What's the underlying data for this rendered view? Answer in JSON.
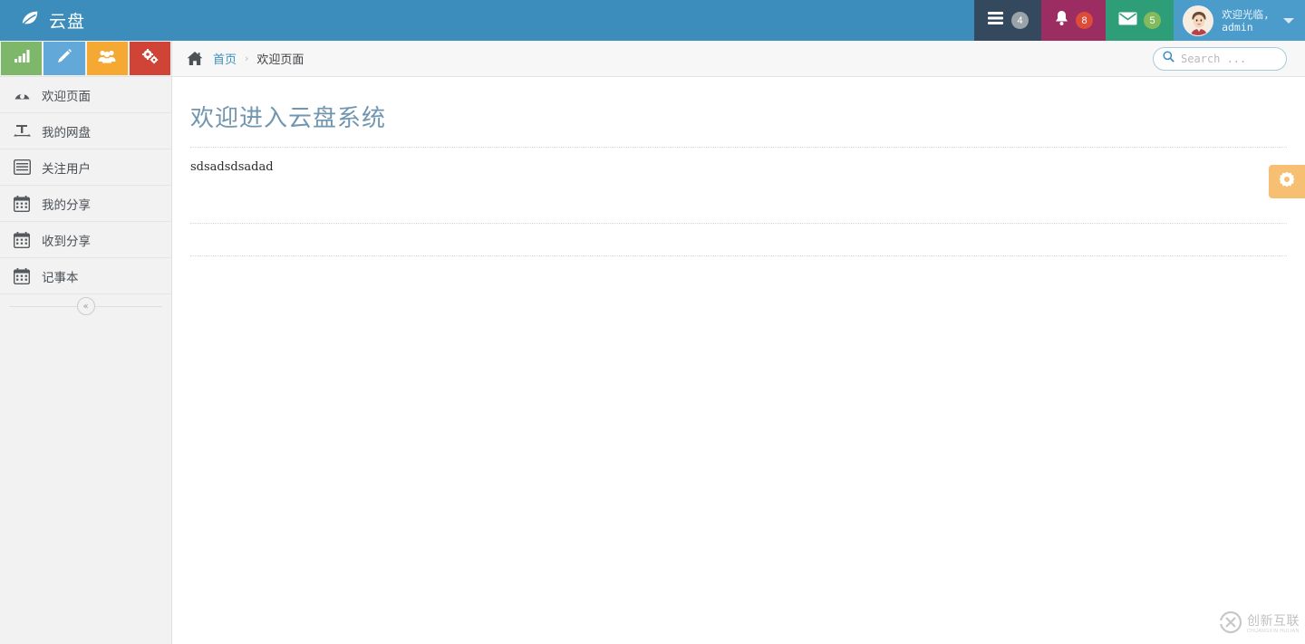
{
  "header": {
    "logo_text": "云盘",
    "logo_icon": "leaf-icon",
    "nav_items": [
      {
        "icon": "tasks-icon",
        "badge": "4",
        "badge_color": "#9aa3a8",
        "bg": "#34495e"
      },
      {
        "icon": "bell-icon",
        "badge": "8",
        "badge_color": "#dd4b39",
        "bg": "#9b2d63"
      },
      {
        "icon": "envelope-icon",
        "badge": "5",
        "badge_color": "#83ba5d",
        "bg": "#2e9e78"
      }
    ],
    "user": {
      "greeting": "欢迎光临,",
      "name": "admin",
      "avatar_icon": "user-avatar",
      "caret_icon": "chevron-down-icon"
    },
    "bg_color": "#3c8dbc"
  },
  "sidebar": {
    "quick_buttons": [
      {
        "name": "stats-button",
        "icon": "bar-chart-icon",
        "color": "#7fb76a"
      },
      {
        "name": "edit-button",
        "icon": "pencil-icon",
        "color": "#62a8d8"
      },
      {
        "name": "users-button",
        "icon": "group-icon",
        "color": "#f5a932"
      },
      {
        "name": "settings-button",
        "icon": "gears-icon",
        "color": "#cf4436"
      }
    ],
    "items": [
      {
        "label": "欢迎页面",
        "icon": "dashboard-icon"
      },
      {
        "label": "我的网盘",
        "icon": "text-height-icon"
      },
      {
        "label": "关注用户",
        "icon": "list-icon"
      },
      {
        "label": "我的分享",
        "icon": "calendar-icon"
      },
      {
        "label": "收到分享",
        "icon": "calendar-icon"
      },
      {
        "label": "记事本",
        "icon": "calendar-icon"
      }
    ],
    "collapse_label": "«",
    "bg_color": "#f2f2f2"
  },
  "breadcrumb": {
    "home_icon": "home-icon",
    "link": "首页",
    "separator": "›",
    "current": "欢迎页面"
  },
  "search": {
    "icon": "search-icon",
    "placeholder": "Search ...",
    "value": ""
  },
  "main": {
    "title": "欢迎进入云盘系统",
    "body_text": "sdsadsdsadad",
    "title_color": "#7196b0"
  },
  "gear_fab": {
    "icon": "gear-icon",
    "color": "#f7bf72"
  },
  "watermark": {
    "cn": "创新互联",
    "en": "CHUANGXIN HULIAN",
    "mark": "cx-logo-icon"
  }
}
